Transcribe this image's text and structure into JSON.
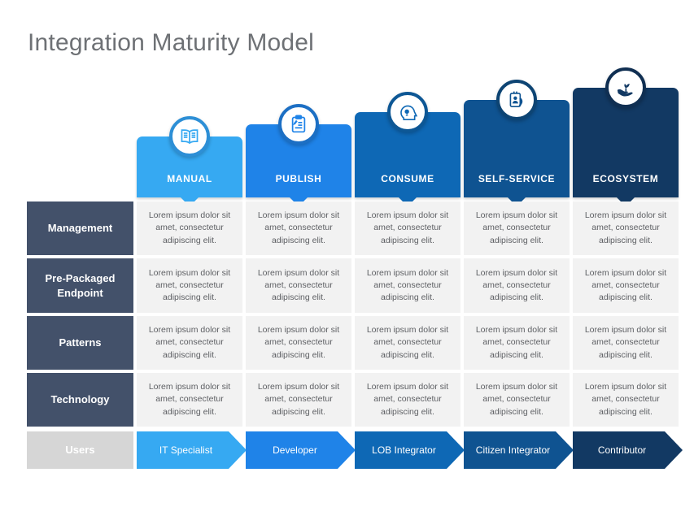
{
  "page_title": "Integration Maturity Model",
  "colors": {
    "title": "#6e7175",
    "row_label": "#43516a",
    "users_label": "#d6d6d6",
    "cell_bg": "#f2f2f2",
    "cell_text": "#5d5f63",
    "stage_1": "#36a9f2",
    "stage_2": "#1f83e8",
    "stage_3": "#0e68b5",
    "stage_4": "#0f5391",
    "stage_5": "#123963",
    "badge_ring": "#0e68b5"
  },
  "stages": [
    {
      "label": "MANUAL",
      "icon": "open-book-icon",
      "color": "#36a9f2",
      "ring": "#2d8fd6",
      "user": "IT Specialist"
    },
    {
      "label": "PUBLISH",
      "icon": "clipboard-pen-icon",
      "color": "#1f83e8",
      "ring": "#1c6fc4",
      "user": "Developer"
    },
    {
      "label": "CONSUME",
      "icon": "head-idea-icon",
      "color": "#0e68b5",
      "ring": "#0d5795",
      "user": "LOB Integrator"
    },
    {
      "label": "SELF-SERVICE",
      "icon": "id-badge-icon",
      "color": "#0f5391",
      "ring": "#0d4473",
      "user": "Citizen Integrator"
    },
    {
      "label": "ECOSYSTEM",
      "icon": "hand-sprout-icon",
      "color": "#123963",
      "ring": "#102f52",
      "user": "Contributor"
    }
  ],
  "rows": [
    {
      "label": "Management",
      "cells": [
        "Lorem  ipsum dolor sit amet, consectetur adipiscing elit.",
        "Lorem  ipsum dolor sit amet, consectetur adipiscing elit.",
        "Lorem  ipsum dolor sit amet, consectetur adipiscing elit.",
        "Lorem  ipsum dolor sit amet, consectetur adipiscing elit.",
        "Lorem  ipsum dolor sit amet, consectetur adipiscing elit."
      ]
    },
    {
      "label": "Pre-Packaged Endpoint",
      "cells": [
        "Lorem  ipsum dolor sit amet, consectetur adipiscing elit.",
        "Lorem  ipsum dolor sit amet, consectetur adipiscing elit.",
        "Lorem  ipsum dolor sit amet, consectetur adipiscing elit.",
        "Lorem  ipsum dolor sit amet, consectetur adipiscing elit.",
        "Lorem  ipsum dolor sit amet, consectetur adipiscing elit."
      ]
    },
    {
      "label": "Patterns",
      "cells": [
        "Lorem  ipsum dolor sit amet, consectetur adipiscing elit.",
        "Lorem  ipsum dolor sit amet, consectetur adipiscing elit.",
        "Lorem  ipsum dolor sit amet, consectetur adipiscing elit.",
        "Lorem  ipsum dolor sit amet, consectetur adipiscing elit.",
        "Lorem  ipsum dolor sit amet, consectetur adipiscing elit."
      ]
    },
    {
      "label": "Technology",
      "cells": [
        "Lorem  ipsum dolor sit amet, consectetur adipiscing elit.",
        "Lorem  ipsum dolor sit amet, consectetur adipiscing elit.",
        "Lorem  ipsum dolor sit amet, consectetur adipiscing elit.",
        "Lorem  ipsum dolor sit amet, consectetur adipiscing elit.",
        "Lorem  ipsum dolor sit amet, consectetur adipiscing elit."
      ]
    }
  ],
  "users_row": {
    "label": "Users",
    "arrows": [
      "IT Specialist",
      "Developer",
      "LOB Integrator",
      "Citizen Integrator",
      "Contributor"
    ]
  }
}
